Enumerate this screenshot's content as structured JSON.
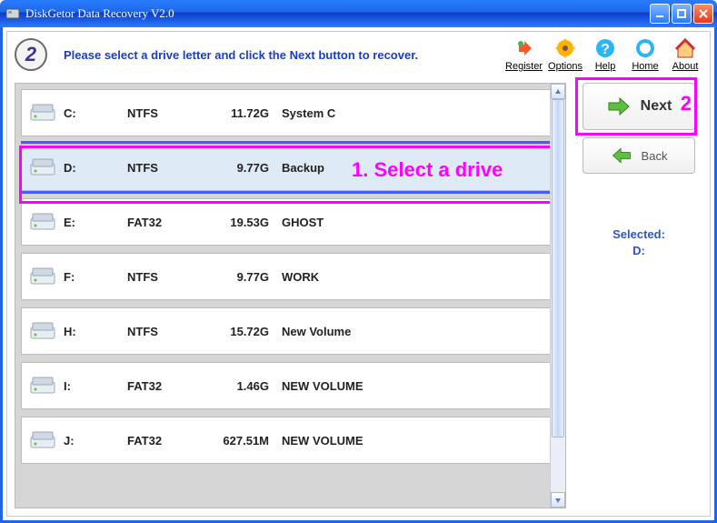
{
  "window": {
    "title": "DiskGetor Data Recovery V2.0"
  },
  "step": {
    "number": "2",
    "prompt": "Please select a drive letter and click the Next button to recover."
  },
  "toolbar": [
    {
      "id": "register",
      "label": "Register"
    },
    {
      "id": "options",
      "label": "Options"
    },
    {
      "id": "help",
      "label": "Help"
    },
    {
      "id": "home",
      "label": "Home"
    },
    {
      "id": "about",
      "label": "About"
    }
  ],
  "drives": [
    {
      "letter": "C:",
      "fs": "NTFS",
      "size": "11.72G",
      "label": "System C",
      "selected": false
    },
    {
      "letter": "D:",
      "fs": "NTFS",
      "size": "9.77G",
      "label": "Backup",
      "selected": true
    },
    {
      "letter": "E:",
      "fs": "FAT32",
      "size": "19.53G",
      "label": "GHOST",
      "selected": false
    },
    {
      "letter": "F:",
      "fs": "NTFS",
      "size": "9.77G",
      "label": "WORK",
      "selected": false
    },
    {
      "letter": "H:",
      "fs": "NTFS",
      "size": "15.72G",
      "label": "New Volume",
      "selected": false
    },
    {
      "letter": "I:",
      "fs": "FAT32",
      "size": "1.46G",
      "label": "NEW VOLUME",
      "selected": false
    },
    {
      "letter": "J:",
      "fs": "FAT32",
      "size": "627.51M",
      "label": "NEW VOLUME",
      "selected": false
    }
  ],
  "nav": {
    "next": "Next",
    "back": "Back"
  },
  "selected": {
    "heading": "Selected:",
    "value": "D:"
  },
  "annotations": {
    "select_drive": "1. Select a drive",
    "next_num": "2"
  }
}
